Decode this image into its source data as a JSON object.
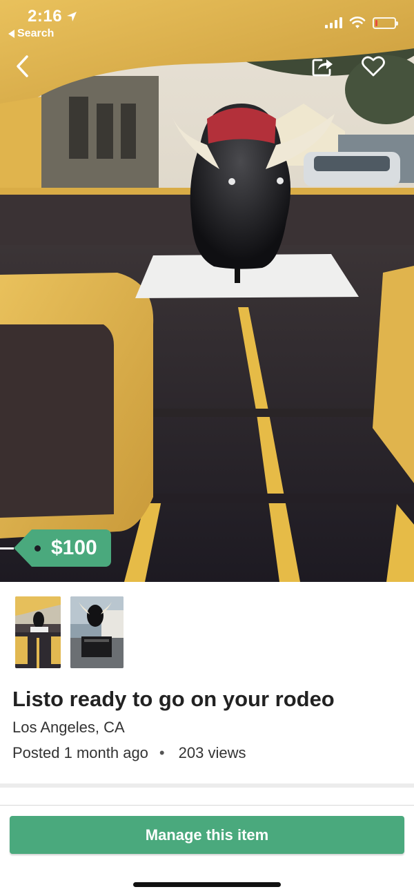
{
  "status_bar": {
    "time": "2:16",
    "back_app_label": "Search"
  },
  "listing": {
    "price": "$100",
    "title": "Listo ready to go on your rodeo",
    "location": "Los Angeles, CA",
    "posted": "Posted 1 month ago",
    "separator": "•",
    "views": "203 views"
  },
  "photos": {
    "thumbnails": [
      "photo-1",
      "photo-2"
    ]
  },
  "actions": {
    "manage_label": "Manage this item"
  },
  "icons": {
    "back": "chevron-left-icon",
    "share": "share-icon",
    "favorite": "heart-icon",
    "location_arrow": "location-arrow-icon",
    "signal": "cellular-signal-icon",
    "wifi": "wifi-icon",
    "battery": "battery-icon"
  },
  "colors": {
    "brand_green": "#4aa97d",
    "battery_low": "#e74c3c",
    "text_primary": "#222222"
  }
}
